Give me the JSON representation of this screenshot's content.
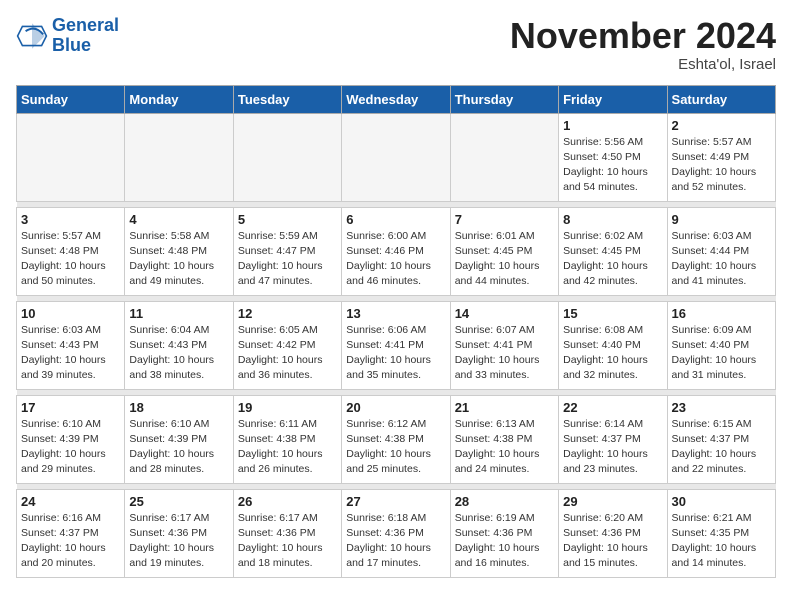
{
  "header": {
    "logo_line1": "General",
    "logo_line2": "Blue",
    "month_title": "November 2024",
    "location": "Eshta'ol, Israel"
  },
  "days_of_week": [
    "Sunday",
    "Monday",
    "Tuesday",
    "Wednesday",
    "Thursday",
    "Friday",
    "Saturday"
  ],
  "weeks": [
    [
      {
        "day": "",
        "detail": ""
      },
      {
        "day": "",
        "detail": ""
      },
      {
        "day": "",
        "detail": ""
      },
      {
        "day": "",
        "detail": ""
      },
      {
        "day": "",
        "detail": ""
      },
      {
        "day": "1",
        "detail": "Sunrise: 5:56 AM\nSunset: 4:50 PM\nDaylight: 10 hours\nand 54 minutes."
      },
      {
        "day": "2",
        "detail": "Sunrise: 5:57 AM\nSunset: 4:49 PM\nDaylight: 10 hours\nand 52 minutes."
      }
    ],
    [
      {
        "day": "3",
        "detail": "Sunrise: 5:57 AM\nSunset: 4:48 PM\nDaylight: 10 hours\nand 50 minutes."
      },
      {
        "day": "4",
        "detail": "Sunrise: 5:58 AM\nSunset: 4:48 PM\nDaylight: 10 hours\nand 49 minutes."
      },
      {
        "day": "5",
        "detail": "Sunrise: 5:59 AM\nSunset: 4:47 PM\nDaylight: 10 hours\nand 47 minutes."
      },
      {
        "day": "6",
        "detail": "Sunrise: 6:00 AM\nSunset: 4:46 PM\nDaylight: 10 hours\nand 46 minutes."
      },
      {
        "day": "7",
        "detail": "Sunrise: 6:01 AM\nSunset: 4:45 PM\nDaylight: 10 hours\nand 44 minutes."
      },
      {
        "day": "8",
        "detail": "Sunrise: 6:02 AM\nSunset: 4:45 PM\nDaylight: 10 hours\nand 42 minutes."
      },
      {
        "day": "9",
        "detail": "Sunrise: 6:03 AM\nSunset: 4:44 PM\nDaylight: 10 hours\nand 41 minutes."
      }
    ],
    [
      {
        "day": "10",
        "detail": "Sunrise: 6:03 AM\nSunset: 4:43 PM\nDaylight: 10 hours\nand 39 minutes."
      },
      {
        "day": "11",
        "detail": "Sunrise: 6:04 AM\nSunset: 4:43 PM\nDaylight: 10 hours\nand 38 minutes."
      },
      {
        "day": "12",
        "detail": "Sunrise: 6:05 AM\nSunset: 4:42 PM\nDaylight: 10 hours\nand 36 minutes."
      },
      {
        "day": "13",
        "detail": "Sunrise: 6:06 AM\nSunset: 4:41 PM\nDaylight: 10 hours\nand 35 minutes."
      },
      {
        "day": "14",
        "detail": "Sunrise: 6:07 AM\nSunset: 4:41 PM\nDaylight: 10 hours\nand 33 minutes."
      },
      {
        "day": "15",
        "detail": "Sunrise: 6:08 AM\nSunset: 4:40 PM\nDaylight: 10 hours\nand 32 minutes."
      },
      {
        "day": "16",
        "detail": "Sunrise: 6:09 AM\nSunset: 4:40 PM\nDaylight: 10 hours\nand 31 minutes."
      }
    ],
    [
      {
        "day": "17",
        "detail": "Sunrise: 6:10 AM\nSunset: 4:39 PM\nDaylight: 10 hours\nand 29 minutes."
      },
      {
        "day": "18",
        "detail": "Sunrise: 6:10 AM\nSunset: 4:39 PM\nDaylight: 10 hours\nand 28 minutes."
      },
      {
        "day": "19",
        "detail": "Sunrise: 6:11 AM\nSunset: 4:38 PM\nDaylight: 10 hours\nand 26 minutes."
      },
      {
        "day": "20",
        "detail": "Sunrise: 6:12 AM\nSunset: 4:38 PM\nDaylight: 10 hours\nand 25 minutes."
      },
      {
        "day": "21",
        "detail": "Sunrise: 6:13 AM\nSunset: 4:38 PM\nDaylight: 10 hours\nand 24 minutes."
      },
      {
        "day": "22",
        "detail": "Sunrise: 6:14 AM\nSunset: 4:37 PM\nDaylight: 10 hours\nand 23 minutes."
      },
      {
        "day": "23",
        "detail": "Sunrise: 6:15 AM\nSunset: 4:37 PM\nDaylight: 10 hours\nand 22 minutes."
      }
    ],
    [
      {
        "day": "24",
        "detail": "Sunrise: 6:16 AM\nSunset: 4:37 PM\nDaylight: 10 hours\nand 20 minutes."
      },
      {
        "day": "25",
        "detail": "Sunrise: 6:17 AM\nSunset: 4:36 PM\nDaylight: 10 hours\nand 19 minutes."
      },
      {
        "day": "26",
        "detail": "Sunrise: 6:17 AM\nSunset: 4:36 PM\nDaylight: 10 hours\nand 18 minutes."
      },
      {
        "day": "27",
        "detail": "Sunrise: 6:18 AM\nSunset: 4:36 PM\nDaylight: 10 hours\nand 17 minutes."
      },
      {
        "day": "28",
        "detail": "Sunrise: 6:19 AM\nSunset: 4:36 PM\nDaylight: 10 hours\nand 16 minutes."
      },
      {
        "day": "29",
        "detail": "Sunrise: 6:20 AM\nSunset: 4:36 PM\nDaylight: 10 hours\nand 15 minutes."
      },
      {
        "day": "30",
        "detail": "Sunrise: 6:21 AM\nSunset: 4:35 PM\nDaylight: 10 hours\nand 14 minutes."
      }
    ]
  ]
}
